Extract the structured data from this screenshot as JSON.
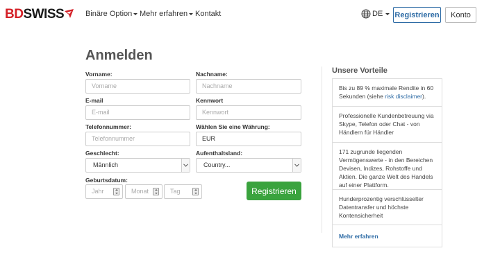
{
  "header": {
    "logo_bd": "BD",
    "logo_swiss": "SWISS",
    "nav": {
      "binary_options": "Binäre Option",
      "learn_more": "Mehr erfahren",
      "contact": "Kontakt"
    },
    "language": "DE",
    "register_label": "Registrieren",
    "account_label": "Konto"
  },
  "form": {
    "title": "Anmelden",
    "first_name": {
      "label": "Vorname:",
      "placeholder": "Vorname"
    },
    "last_name": {
      "label": "Nachname:",
      "placeholder": "Nachname"
    },
    "email": {
      "label": "E-mail",
      "placeholder": "E-mail"
    },
    "password": {
      "label": "Kennwort",
      "placeholder": "Kennwort"
    },
    "phone": {
      "label": "Telefonnummer:",
      "placeholder": "Telefonnummer"
    },
    "currency": {
      "label": "Wählen Sie eine Währung:",
      "value": "EUR"
    },
    "gender": {
      "label": "Geschlecht:",
      "value": "Männlich"
    },
    "country": {
      "label": "Aufenthaltsland:",
      "value": "Country..."
    },
    "birthdate": {
      "label": "Geburtsdatum:",
      "year_placeholder": "Jahr",
      "month_placeholder": "Monat",
      "day_placeholder": "Tag"
    },
    "submit_label": "Registrieren"
  },
  "sidebar": {
    "title": "Unsere Vorteile",
    "items": [
      {
        "text": "Bis zu 89 % maximale Rendite in 60 Sekunden (siehe ",
        "link": "risk disclaimer",
        "suffix": ")."
      },
      {
        "text": "Professionelle Kundenbetreuung via Skype, Telefon oder Chat - von Händlern für Händler"
      },
      {
        "text": "171 zugrunde liegenden Vermögenswerte - in den Bereichen Devisen, Indizes, Rohstoffe und Aktien. Die ganze Welt des Handels auf einer Plattform."
      },
      {
        "text": "Hunderprozentig verschlüsselter Datentransfer und höchste Kontensicherheit"
      }
    ],
    "more_label": "Mehr erfahren"
  },
  "colors": {
    "brand_red": "#d42027",
    "link_blue": "#2d6ba5",
    "submit_green": "#3aa33e"
  }
}
